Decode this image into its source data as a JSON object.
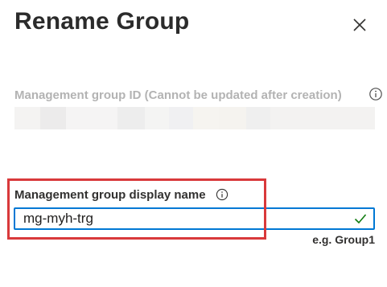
{
  "dialog": {
    "title": "Rename Group",
    "close_icon": "close-icon"
  },
  "group_id": {
    "label": "Management group ID (Cannot be updated after creation)",
    "info_icon": "info-icon",
    "value_blurred": true
  },
  "display_name": {
    "label": "Management group display name",
    "info_icon": "info-icon",
    "value": "mg-myh-trg",
    "valid_icon": "checkmark-icon",
    "hint": "e.g. Group1"
  },
  "colors": {
    "accent": "#0078d4",
    "valid": "#107c10",
    "highlight": "#d9393b"
  }
}
